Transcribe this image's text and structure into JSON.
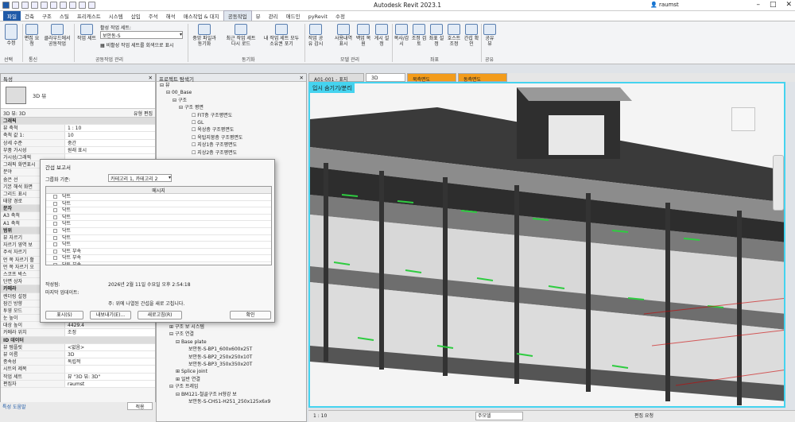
{
  "app": {
    "title": "Autodesk Revit 2023.1",
    "user": "raumst",
    "win_controls": [
      "–",
      "□",
      "✕"
    ]
  },
  "tabs": [
    "파일",
    "건축",
    "구조",
    "스틸",
    "프리캐스트",
    "시스템",
    "삽입",
    "주석",
    "해석",
    "매스작업 & 대지",
    "공동작업",
    "뷰",
    "관리",
    "애드인",
    "pyRevit",
    "수정"
  ],
  "ribbon": {
    "modify": "수정",
    "select": "선택",
    "comm_buttons": [
      "편집 요청",
      "클라우드에서 공동작업"
    ],
    "comm_group": "통신",
    "worksets_label": "작업 세트",
    "active_workset_label": "활성 작업 세트:",
    "active_workset": "보안동-S",
    "gray_inactive": "비활성 작업 세트를 회색으로 표시",
    "collab_mgmt": "공동작업 관리",
    "sync_buttons": [
      "중앙 파일과 동기화",
      "최근 작업 세트 다시 로드",
      "내 작업 세트 모두 소유권 포기"
    ],
    "sync_group": "동기화",
    "manage_buttons": [
      "작업 공유 감시",
      "사용내역 표시",
      "백업 복원",
      "게시 설정"
    ],
    "manage_group": "모델 관리",
    "coord_buttons": [
      "복사/감시",
      "조정 검토",
      "좌표 설정",
      "호스트 조정",
      "간섭 확인"
    ],
    "coord_group": "좌표",
    "share_buttons": [
      "공유 뷰"
    ],
    "share_group": "공유"
  },
  "properties": {
    "header": "특성",
    "type_name": "3D 뷰",
    "selector": "3D 뷰: 3D",
    "edit_type": "유형 편집",
    "rows": [
      {
        "k": "그래픽",
        "v": "",
        "sec": true
      },
      {
        "k": "뷰 축척",
        "v": "1 : 10"
      },
      {
        "k": "축척 값   1:",
        "v": "10"
      },
      {
        "k": "상세 수준",
        "v": "중간"
      },
      {
        "k": "부품 가시성",
        "v": "원래 표시"
      },
      {
        "k": "가시성/그래픽",
        "v": ""
      },
      {
        "k": "그래픽 화면표시",
        "v": ""
      },
      {
        "k": "분야",
        "v": ""
      },
      {
        "k": "숨은 선",
        "v": ""
      },
      {
        "k": "기본 해석 화면",
        "v": ""
      },
      {
        "k": "그리드 표시",
        "v": ""
      },
      {
        "k": "태양 경로",
        "v": ""
      },
      {
        "k": "문자",
        "v": "",
        "sec": true
      },
      {
        "k": "A3 축척",
        "v": ""
      },
      {
        "k": "A1 축척",
        "v": ""
      },
      {
        "k": "범위",
        "v": "",
        "sec": true
      },
      {
        "k": "뷰 자르기",
        "v": ""
      },
      {
        "k": "자르기 영역 보",
        "v": ""
      },
      {
        "k": "주석 자르기",
        "v": ""
      },
      {
        "k": "먼 쪽 자르기 활",
        "v": ""
      },
      {
        "k": "먼 쪽 자르기 오",
        "v": ""
      },
      {
        "k": "스코프 박스",
        "v": ""
      },
      {
        "k": "단면 상자",
        "v": ""
      },
      {
        "k": "카메라",
        "v": "",
        "sec": true
      },
      {
        "k": "렌더링 설정",
        "v": ""
      },
      {
        "k": "잠긴 방향",
        "v": ""
      },
      {
        "k": "투영 모드",
        "v": ""
      },
      {
        "k": "눈 높이",
        "v": "9728.9"
      },
      {
        "k": "대상 높이",
        "v": "4429.4"
      },
      {
        "k": "카메라 위치",
        "v": "조정"
      },
      {
        "k": "ID 데이터",
        "v": "",
        "sec": true
      },
      {
        "k": "뷰 템플릿",
        "v": "<없음>"
      },
      {
        "k": "뷰 이름",
        "v": "3D"
      },
      {
        "k": "종속성",
        "v": "독립적"
      },
      {
        "k": "시트의 제목",
        "v": ""
      },
      {
        "k": "작업 세트",
        "v": "뷰 \"3D 뷰: 3D\""
      },
      {
        "k": "편집자",
        "v": "raumst"
      }
    ],
    "help": "특성 도움말",
    "apply": "적용"
  },
  "browser": {
    "header": "프로젝트 탐색기",
    "root": "뷰",
    "items": [
      "00_Base",
      "구조",
      "구조 평면",
      "FIT층 구조평면도",
      "GL",
      "옥상층 구조평면도",
      "옥탑지붕층 구조평면도",
      "지상1층 구조평면도",
      "지상2층 구조평면도"
    ],
    "lower": [
      "구조 보 시스템",
      "구조 연결",
      "Base plate",
      "보안동-S-BP1_600x600x25T",
      "보안동-S-BP2_250x250x10T",
      "보안동-S-BP3_350x350x20T",
      "Splice joint",
      "일반 연결",
      "구조 프레임",
      "BM121-철골구조 H형강 보",
      "보안동-S-CHS1-H251_250x125x6x9"
    ]
  },
  "dialog": {
    "title": "간섭 보고서",
    "group_by_label": "그룹화 기준:",
    "group_by": "카테고리 1, 카테고리 2",
    "col": "메시지",
    "rows": [
      "닥트",
      "닥트",
      "닥트",
      "닥트",
      "닥트",
      "닥트",
      "닥트",
      "닥트",
      "닥트 부속",
      "닥트 부속",
      "닥트 부속"
    ],
    "created_label": "작성됨:",
    "created": "2026년 2월 11일 수요일 오후 2:54:18",
    "updated_label": "마지막 업데이트:",
    "note": "주: 위에 나열된 간섭을 새로 고칩니다.",
    "btn_show": "표시(S)",
    "btn_export": "내보내기(E)...",
    "btn_refresh": "새로고침(R)",
    "btn_ok": "확인"
  },
  "view_tabs": [
    "A01-001 - 표지",
    "3D",
    "북측면도",
    "동측면도"
  ],
  "viewport_label": "입시 숨기기/분리",
  "status": {
    "scale": "1 : 10",
    "model": "주모델",
    "main": "편집 요청"
  },
  "colors": {
    "accent": "#1f5aa8",
    "viewport_border": "#45d3ef",
    "clash": "#2ecc40",
    "orange": "#f39c1b"
  }
}
